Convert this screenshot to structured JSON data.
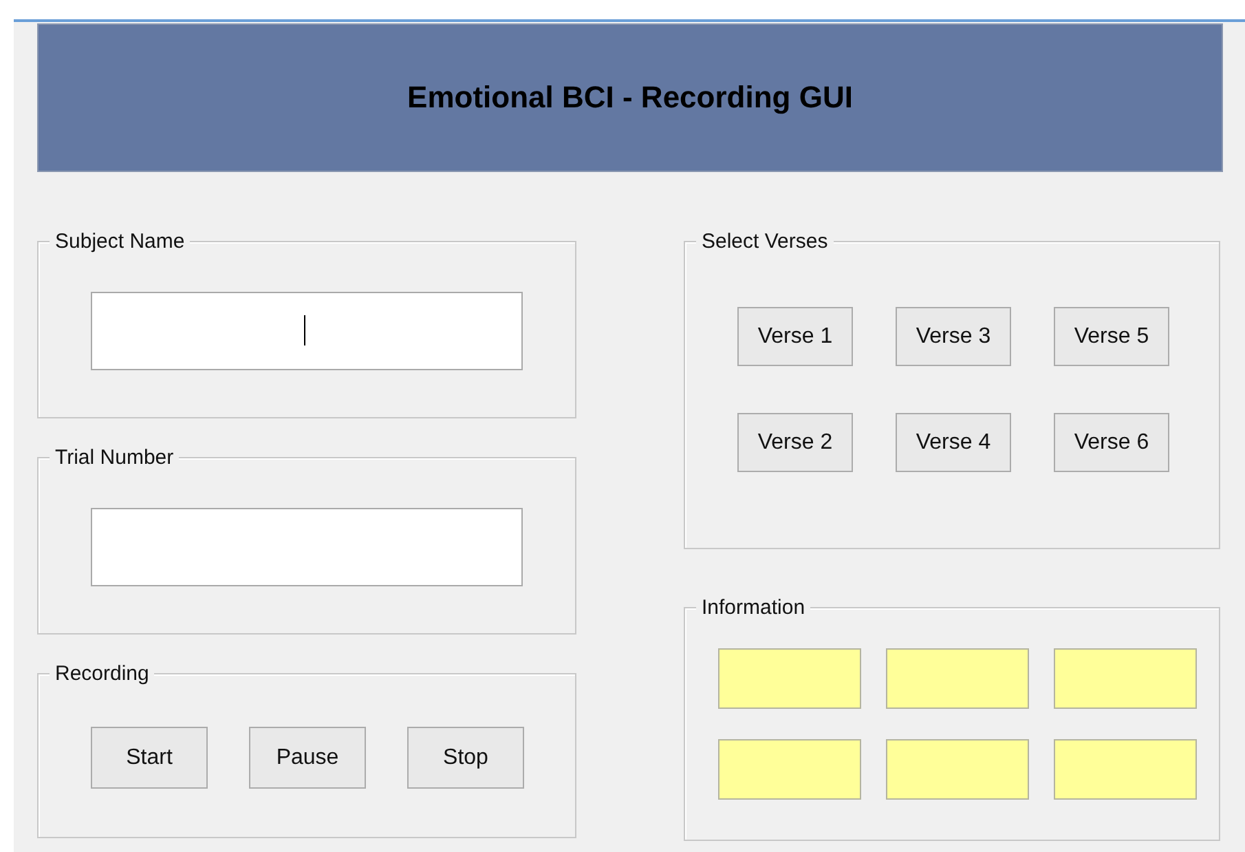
{
  "title": "Emotional BCI - Recording GUI",
  "subject_name": {
    "label": "Subject Name",
    "focused": true
  },
  "trial_number": {
    "label": "Trial Number",
    "focused": false
  },
  "recording": {
    "label": "Recording",
    "buttons": [
      "Start",
      "Pause",
      "Stop"
    ]
  },
  "select_verses": {
    "label": "Select Verses",
    "buttons": [
      "Verse 1",
      "Verse 3",
      "Verse 5",
      "Verse 2",
      "Verse 4",
      "Verse 6"
    ]
  },
  "information": {
    "label": "Information",
    "displays": [
      {
        "kind": "display"
      },
      {
        "kind": "display"
      },
      {
        "kind": "display"
      },
      {
        "kind": "display"
      },
      {
        "kind": "display"
      },
      {
        "kind": "display"
      }
    ]
  }
}
